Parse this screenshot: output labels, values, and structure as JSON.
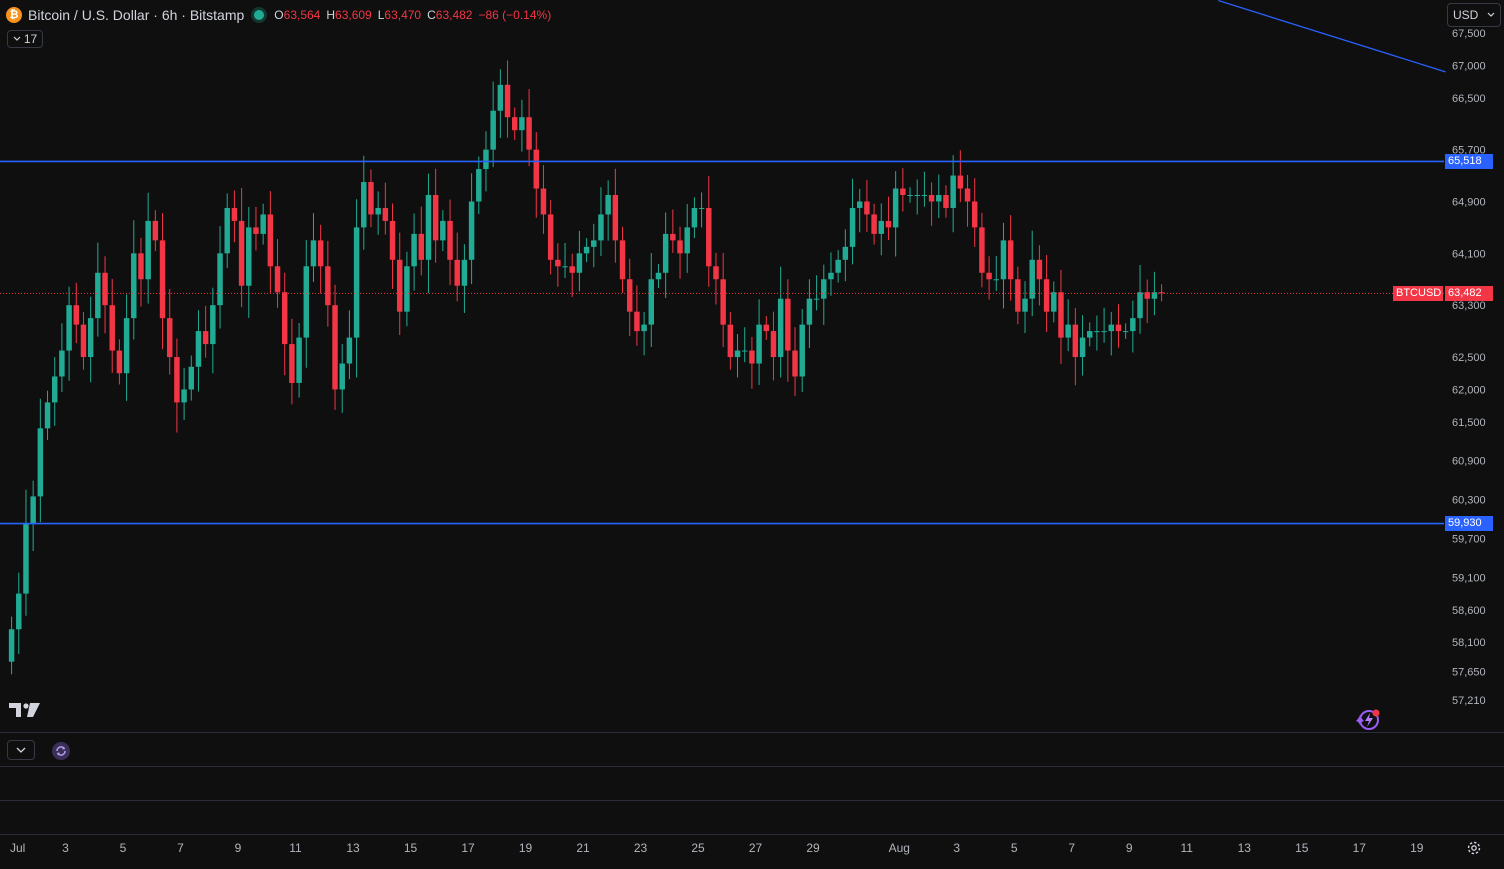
{
  "header": {
    "coin_icon": "bitcoin-icon",
    "symbol_title": "Bitcoin / U.S. Dollar · 6h · Bitstamp",
    "market_status": "market-open-dot-icon",
    "ohlc": [
      {
        "label": "O",
        "value": "63,564"
      },
      {
        "label": "H",
        "value": "63,609"
      },
      {
        "label": "L",
        "value": "63,470"
      },
      {
        "label": "C",
        "value": "63,482"
      }
    ],
    "change": "−86 (−0.14%)",
    "indicators_count": "17"
  },
  "currency": "USD",
  "colors": {
    "up": "#22ab94",
    "down": "#f23645",
    "line": "#2962ff",
    "bg": "#0f0f0f"
  },
  "chart_data": {
    "type": "candlestick",
    "symbol": "BTCUSD",
    "interval": "6h",
    "ylim": [
      56900,
      67700
    ],
    "y_ticks": [
      "67,500",
      "67,000",
      "66,500",
      "65,700",
      "64,900",
      "64,100",
      "63,300",
      "62,500",
      "62,000",
      "61,500",
      "60,900",
      "60,300",
      "59,700",
      "59,100",
      "58,600",
      "58,100",
      "57,650",
      "57,210"
    ],
    "y_tick_values": [
      67500,
      67000,
      66500,
      65700,
      64900,
      64100,
      63300,
      62500,
      62000,
      61500,
      60900,
      60300,
      59700,
      59100,
      58600,
      58100,
      57650,
      57210
    ],
    "x_ticks": [
      {
        "label": "Jul",
        "day": 0
      },
      {
        "label": "3",
        "day": 2
      },
      {
        "label": "5",
        "day": 4
      },
      {
        "label": "7",
        "day": 6
      },
      {
        "label": "9",
        "day": 8
      },
      {
        "label": "11",
        "day": 10
      },
      {
        "label": "13",
        "day": 12
      },
      {
        "label": "15",
        "day": 14
      },
      {
        "label": "17",
        "day": 16
      },
      {
        "label": "19",
        "day": 18
      },
      {
        "label": "21",
        "day": 20
      },
      {
        "label": "23",
        "day": 22
      },
      {
        "label": "25",
        "day": 24
      },
      {
        "label": "27",
        "day": 26
      },
      {
        "label": "29",
        "day": 28
      },
      {
        "label": "Aug",
        "day": 31
      },
      {
        "label": "3",
        "day": 33
      },
      {
        "label": "5",
        "day": 35
      },
      {
        "label": "7",
        "day": 37
      },
      {
        "label": "9",
        "day": 39
      },
      {
        "label": "11",
        "day": 41
      },
      {
        "label": "13",
        "day": 43
      },
      {
        "label": "15",
        "day": 45
      },
      {
        "label": "17",
        "day": 47
      },
      {
        "label": "19",
        "day": 49
      }
    ],
    "horizontal_lines": [
      {
        "label": "65,518",
        "value": 65518
      },
      {
        "label": "59,930",
        "value": 59930
      }
    ],
    "trend_line": {
      "from": {
        "day": 42.1,
        "value": 68000
      },
      "to": {
        "day": 50.0,
        "value": 66900
      }
    },
    "last_price": {
      "symbol": "BTCUSD",
      "label": "63,482",
      "value": 63482
    },
    "closes": [
      58300,
      58850,
      59930,
      60350,
      61400,
      61800,
      62200,
      62600,
      63300,
      63000,
      62500,
      63100,
      63800,
      63300,
      62600,
      62250,
      63100,
      64100,
      63700,
      64600,
      64300,
      63100,
      62500,
      61800,
      62000,
      62350,
      62900,
      62700,
      63300,
      64100,
      64800,
      64600,
      63600,
      64500,
      64400,
      64700,
      63900,
      63500,
      62700,
      62100,
      62800,
      63900,
      64300,
      63900,
      63300,
      62000,
      62400,
      62800,
      64500,
      65200,
      64700,
      64800,
      64600,
      64000,
      63200,
      63900,
      64400,
      64000,
      65000,
      64300,
      64600,
      64000,
      63600,
      64000,
      64900,
      65400,
      65700,
      66300,
      66700,
      66200,
      66000,
      66200,
      65700,
      65100,
      64700,
      64000,
      63900,
      63900,
      63800,
      64100,
      64200,
      64300,
      64700,
      65000,
      64300,
      63700,
      63200,
      62900,
      63000,
      63700,
      63800,
      64400,
      64300,
      64100,
      64500,
      64800,
      64800,
      63900,
      63700,
      63000,
      62500,
      62600,
      62600,
      62400,
      63000,
      62900,
      62500,
      63400,
      62600,
      62200,
      63000,
      63400,
      63400,
      63700,
      63800,
      64000,
      64200,
      64800,
      64900,
      64700,
      64400,
      64600,
      64500,
      65100,
      65000,
      65000,
      65000,
      65000,
      64900,
      65000,
      64800,
      65300,
      65100,
      64900,
      64500,
      63800,
      63700,
      63700,
      64300,
      63700,
      63200,
      63400,
      64000,
      63700,
      63200,
      63500,
      62800,
      63000,
      62500,
      62800,
      62900,
      62900,
      62900,
      63000,
      62900,
      62900,
      63100,
      63500,
      63400,
      63500,
      63482
    ],
    "candles_per_day": 4
  },
  "pane": {
    "collapse_icon": "chevron-down-icon",
    "replay_icon": "refresh-icon"
  },
  "footer": {
    "settings_icon": "gear-icon"
  },
  "branding": {
    "logo": "tradingview-logo"
  }
}
